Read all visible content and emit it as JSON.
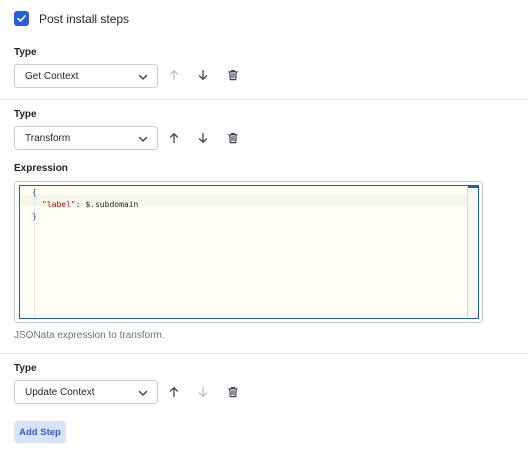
{
  "post_install": {
    "label": "Post install steps",
    "checked": true
  },
  "steps": [
    {
      "type_label": "Type",
      "type_value": "Get Context",
      "move_up_enabled": false,
      "move_down_enabled": true
    },
    {
      "type_label": "Type",
      "type_value": "Transform",
      "move_up_enabled": true,
      "move_down_enabled": true,
      "expression_label": "Expression",
      "expression_code": {
        "line1": "{",
        "key": "\"label\"",
        "colon": ": ",
        "value": "$.subdomain",
        "line3": "}"
      },
      "hint": "JSONata expression to transform."
    },
    {
      "type_label": "Type",
      "type_value": "Update Context",
      "move_up_enabled": true,
      "move_down_enabled": false
    }
  ],
  "add_step_label": "Add Step",
  "colors": {
    "accent": "#2b5fd9",
    "accent_soft": "#d8e2fb",
    "disabled_icon": "#b8bec8",
    "icon": "#3d4450"
  }
}
